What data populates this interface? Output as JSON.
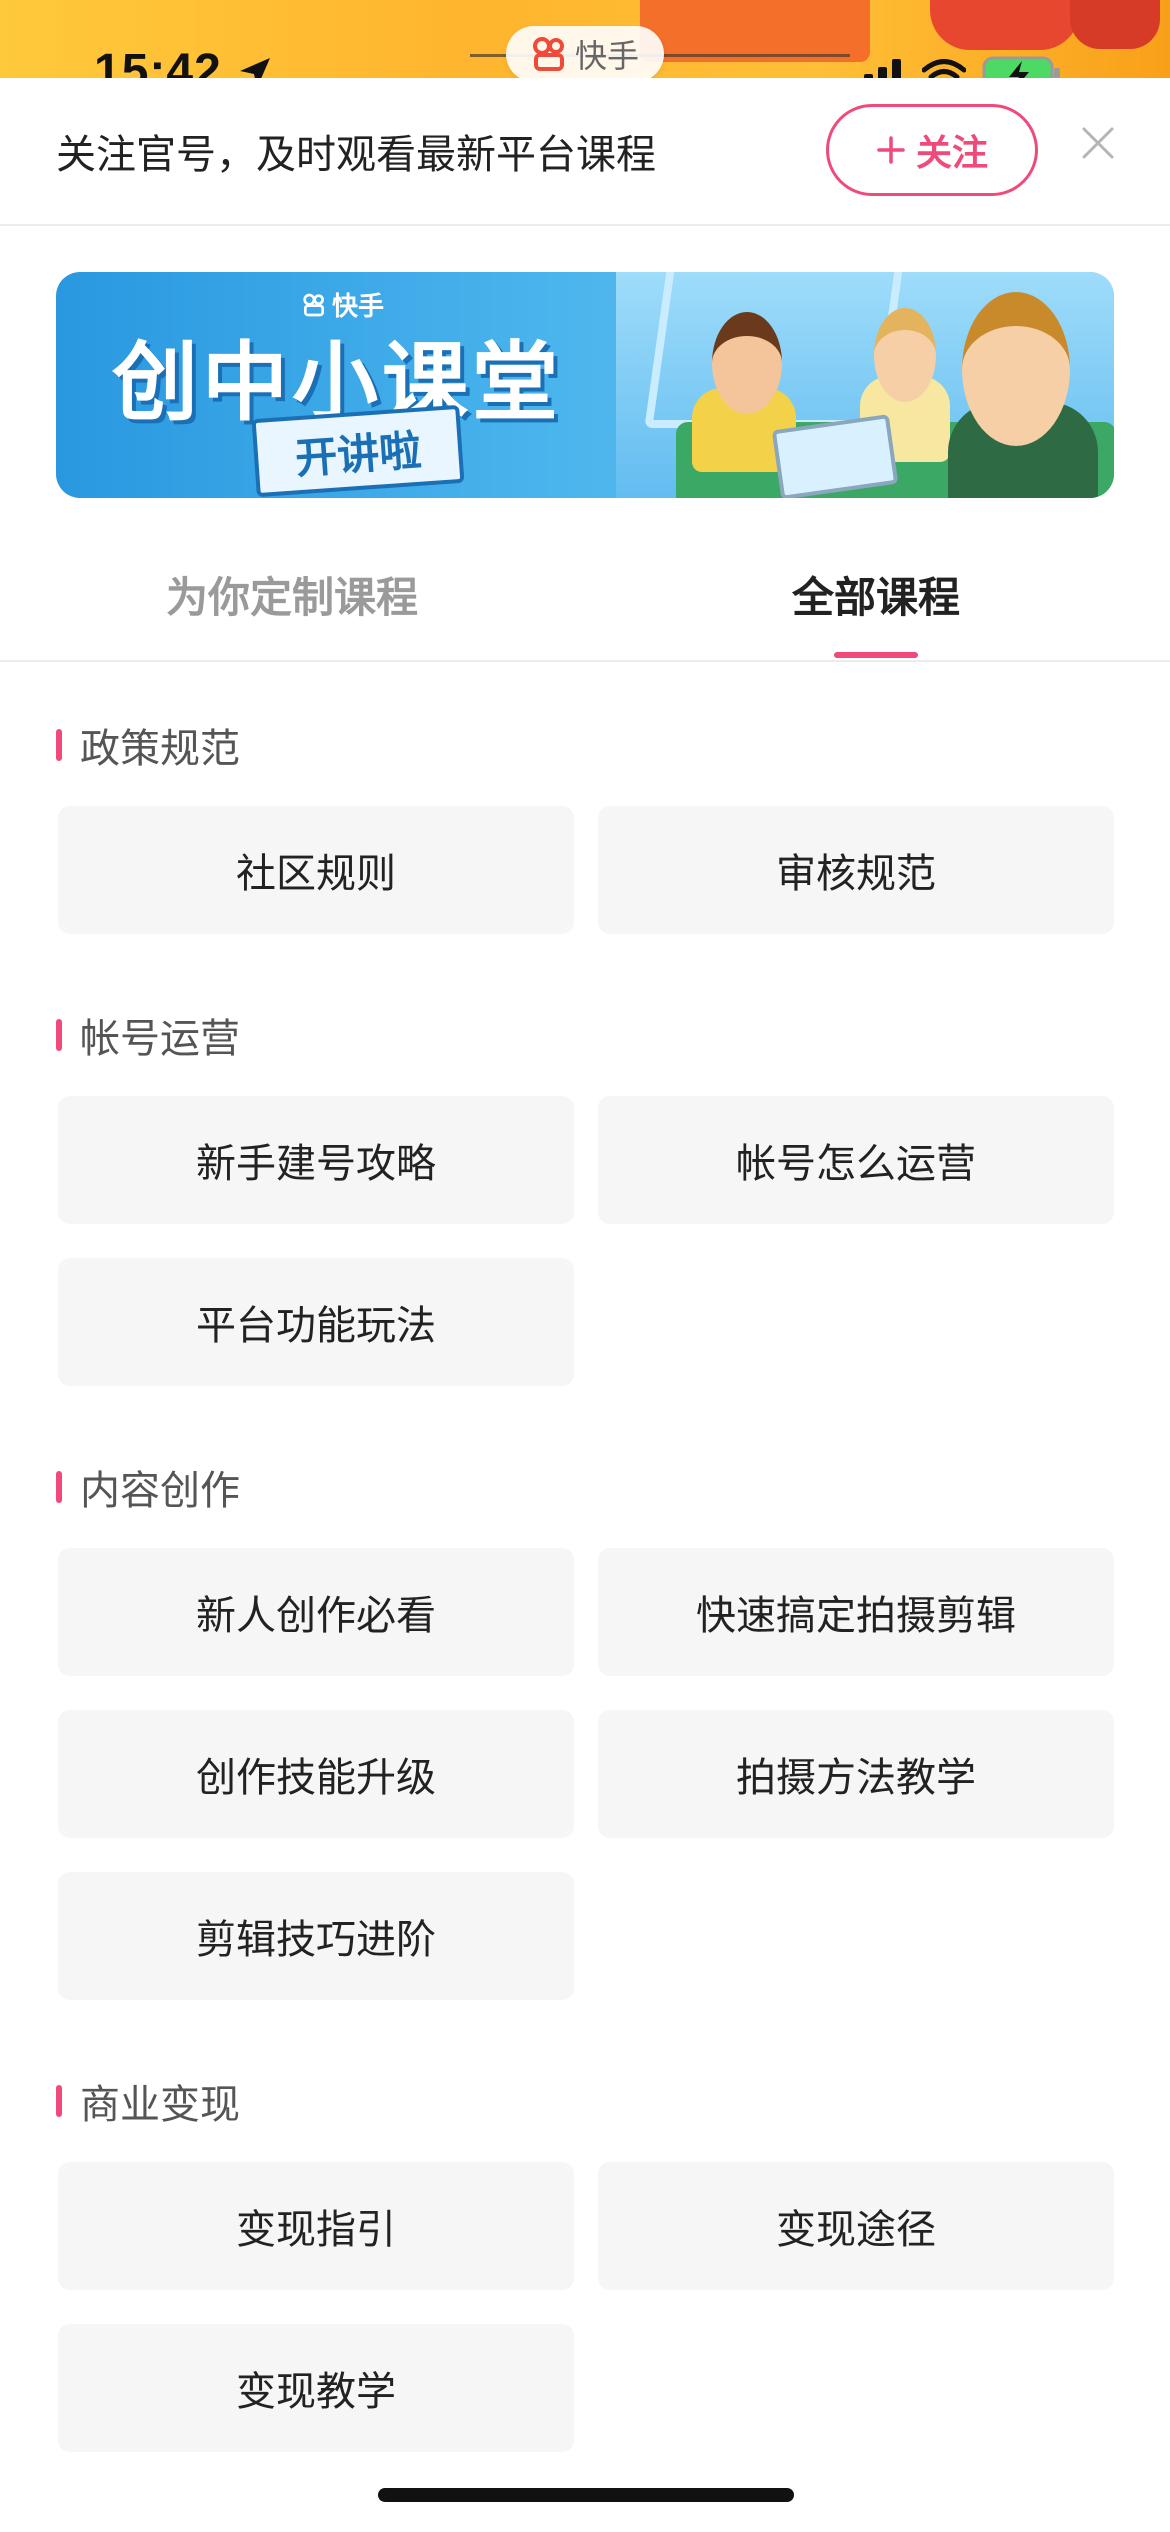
{
  "status_bar": {
    "time": "15:42",
    "app_name": "快手"
  },
  "follow_banner": {
    "text": "关注官号，及时观看最新平台课程",
    "follow_button": "关注"
  },
  "hero_banner": {
    "brand": "快手",
    "title": "创中小课堂",
    "subtitle": "开讲啦"
  },
  "tabs": [
    {
      "label": "为你定制课程",
      "active": false
    },
    {
      "label": "全部课程",
      "active": true
    }
  ],
  "sections": [
    {
      "title": "政策规范",
      "items": [
        "社区规则",
        "审核规范"
      ]
    },
    {
      "title": "帐号运营",
      "items": [
        "新手建号攻略",
        "帐号怎么运营",
        "平台功能玩法"
      ]
    },
    {
      "title": "内容创作",
      "items": [
        "新人创作必看",
        "快速搞定拍摄剪辑",
        "创作技能升级",
        "拍摄方法教学",
        "剪辑技巧进阶"
      ]
    },
    {
      "title": "商业变现",
      "items": [
        "变现指引",
        "变现途径",
        "变现教学"
      ]
    }
  ],
  "colors": {
    "accent": "#f04a7a",
    "card_bg": "#f6f6f6"
  }
}
